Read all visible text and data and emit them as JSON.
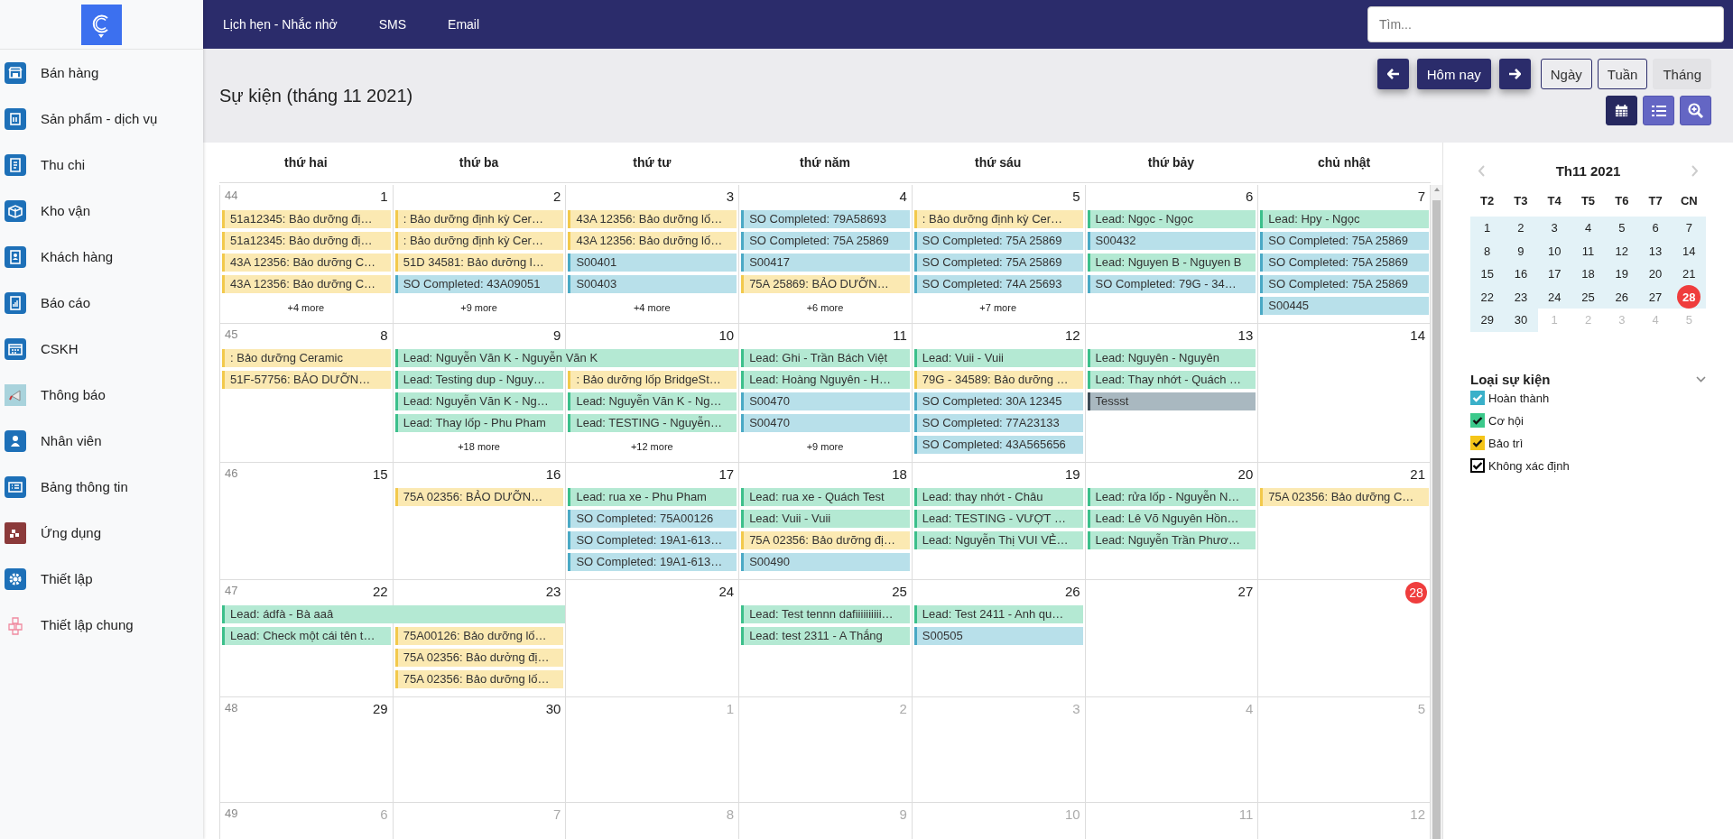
{
  "sidebar": {
    "items": [
      {
        "label": "Bán hàng"
      },
      {
        "label": "Sản phẩm - dịch vụ"
      },
      {
        "label": "Thu chi"
      },
      {
        "label": "Kho vận"
      },
      {
        "label": "Khách hàng"
      },
      {
        "label": "Báo cáo"
      },
      {
        "label": "CSKH"
      },
      {
        "label": "Thông báo"
      },
      {
        "label": "Nhân viên"
      },
      {
        "label": "Bảng thông tin"
      },
      {
        "label": "Ứng dụng"
      },
      {
        "label": "Thiết lập"
      },
      {
        "label": "Thiết lập chung"
      }
    ]
  },
  "top_nav": {
    "items": [
      {
        "label": "Lịch hẹn - Nhắc nhở"
      },
      {
        "label": "SMS"
      },
      {
        "label": "Email"
      }
    ]
  },
  "search": {
    "placeholder": "Tìm..."
  },
  "page_title": "Sự kiện (tháng 11 2021)",
  "toolbar": {
    "today_button": "Hôm nay",
    "views": [
      {
        "label": "Ngày",
        "selected": false
      },
      {
        "label": "Tuần",
        "selected": false
      },
      {
        "label": "Tháng",
        "selected": true
      }
    ],
    "display_buttons": [
      {
        "kind": "calendar",
        "selected": true
      },
      {
        "kind": "list",
        "selected": false
      },
      {
        "kind": "zoom",
        "selected": false
      }
    ]
  },
  "calendar": {
    "weekday_headers": [
      "thứ hai",
      "thứ ba",
      "thứ tư",
      "thứ năm",
      "thứ sáu",
      "thứ bảy",
      "chủ nhật"
    ],
    "weeks": [
      {
        "week": "44",
        "days": [
          {
            "number": "1",
            "other_month": false,
            "today": false,
            "more": "+4 more",
            "events": [
              {
                "kind": "maintenance",
                "text": "51a12345: Bảo dưỡng đị…",
                "continues": false
              },
              {
                "kind": "maintenance",
                "text": "51a12345: Bảo dưỡng đị…",
                "continues": false
              },
              {
                "kind": "maintenance",
                "text": "43A 12356: Bảo dưỡng C…",
                "continues": false
              },
              {
                "kind": "maintenance",
                "text": "43A 12356: Bảo dưỡng C…",
                "continues": false
              }
            ]
          },
          {
            "number": "2",
            "other_month": false,
            "today": false,
            "more": "+9 more",
            "events": [
              {
                "kind": "maintenance",
                "text": ": Bảo dưỡng định kỳ Cer…",
                "continues": false
              },
              {
                "kind": "maintenance",
                "text": ": Bảo dưỡng định kỳ Cer…",
                "continues": false
              },
              {
                "kind": "maintenance",
                "text": "51D 34581: Bảo dưỡng l…",
                "continues": false
              },
              {
                "kind": "completed",
                "text": "SO Completed: 43A09051",
                "continues": false
              }
            ]
          },
          {
            "number": "3",
            "other_month": false,
            "today": false,
            "more": "+4 more",
            "events": [
              {
                "kind": "maintenance",
                "text": "43A 12356: Bảo dưỡng lố…",
                "continues": false
              },
              {
                "kind": "maintenance",
                "text": "43A 12356: Bảo dưỡng lố…",
                "continues": false
              },
              {
                "kind": "completed",
                "text": "S00401",
                "continues": false
              },
              {
                "kind": "completed",
                "text": "S00403",
                "continues": false
              }
            ]
          },
          {
            "number": "4",
            "other_month": false,
            "today": false,
            "more": "+6 more",
            "events": [
              {
                "kind": "completed",
                "text": "SO Completed: 79A58693",
                "continues": false
              },
              {
                "kind": "completed",
                "text": "SO Completed: 75A 25869",
                "continues": false
              },
              {
                "kind": "completed",
                "text": "S00417",
                "continues": false
              },
              {
                "kind": "maintenance",
                "text": "75A 25869: BẢO DƯỠN…",
                "continues": false
              }
            ]
          },
          {
            "number": "5",
            "other_month": false,
            "today": false,
            "more": "+7 more",
            "events": [
              {
                "kind": "maintenance",
                "text": ": Bảo dưỡng định kỳ Cer…",
                "continues": false
              },
              {
                "kind": "completed",
                "text": "SO Completed: 75A 25869",
                "continues": false
              },
              {
                "kind": "completed",
                "text": "SO Completed: 75A 25869",
                "continues": false
              },
              {
                "kind": "completed",
                "text": "SO Completed: 74A 25693",
                "continues": false
              }
            ]
          },
          {
            "number": "6",
            "other_month": false,
            "today": false,
            "events": [
              {
                "kind": "lead",
                "text": "Lead: Ngọc - Ngọc",
                "continues": false
              },
              {
                "kind": "completed",
                "text": "S00432",
                "continues": false
              },
              {
                "kind": "lead",
                "text": "Lead: Nguyen B - Nguyen B",
                "continues": false
              },
              {
                "kind": "completed",
                "text": "SO Completed: 79G - 34…",
                "continues": false
              }
            ]
          },
          {
            "number": "7",
            "other_month": false,
            "today": false,
            "events": [
              {
                "kind": "lead",
                "text": "Lead: Hpy - Ngọc",
                "continues": false
              },
              {
                "kind": "completed",
                "text": "SO Completed: 75A 25869",
                "continues": false
              },
              {
                "kind": "completed",
                "text": "SO Completed: 75A 25869",
                "continues": false
              },
              {
                "kind": "completed",
                "text": "SO Completed: 75A 25869",
                "continues": false
              },
              {
                "kind": "completed",
                "text": "S00445",
                "continues": false
              }
            ]
          }
        ]
      },
      {
        "week": "45",
        "days": [
          {
            "number": "8",
            "other_month": false,
            "today": false,
            "events": [
              {
                "kind": "maintenance",
                "text": ": Bảo dưỡng Ceramic",
                "continues": false
              },
              {
                "kind": "maintenance",
                "text": "51F-57756: BẢO DƯỠN…",
                "continues": false
              }
            ]
          },
          {
            "number": "9",
            "other_month": false,
            "today": false,
            "more": "+18 more",
            "events": [
              {
                "kind": "lead",
                "text": "Lead: Nguyễn Văn K - Nguyễn Văn K",
                "continues": true
              },
              {
                "kind": "lead",
                "text": "Lead: Testing dup - Nguy…",
                "continues": false
              },
              {
                "kind": "lead",
                "text": "Lead: Nguyễn Văn K - Ng…",
                "continues": false
              },
              {
                "kind": "lead",
                "text": "Lead: Thay lốp - Phu Pham",
                "continues": false
              }
            ]
          },
          {
            "number": "10",
            "other_month": false,
            "today": false,
            "more": "+12 more",
            "events": [
              {
                "kind": "maintenance",
                "text": ": Bảo dưỡng lốp BridgeSt…",
                "continues": false
              },
              {
                "kind": "lead",
                "text": "Lead: Nguyễn Văn K - Ng…",
                "continues": false
              },
              {
                "kind": "lead",
                "text": "Lead: TESTING - Nguyễn…",
                "continues": false
              }
            ]
          },
          {
            "number": "11",
            "other_month": false,
            "today": false,
            "more": "+9 more",
            "events": [
              {
                "kind": "lead",
                "text": "Lead: Ghi - Trần Bách Việt",
                "continues": false
              },
              {
                "kind": "lead",
                "text": "Lead: Hoàng Nguyên - H…",
                "continues": false
              },
              {
                "kind": "completed",
                "text": "S00470",
                "continues": false
              },
              {
                "kind": "completed",
                "text": "S00470",
                "continues": false
              }
            ]
          },
          {
            "number": "12",
            "other_month": false,
            "today": false,
            "events": [
              {
                "kind": "lead",
                "text": "Lead: Vuii - Vuii",
                "continues": false
              },
              {
                "kind": "maintenance",
                "text": "79G - 34589: Bảo dưỡng …",
                "continues": false
              },
              {
                "kind": "completed",
                "text": "SO Completed: 30A 12345",
                "continues": false
              },
              {
                "kind": "completed",
                "text": "SO Completed: 77A23133",
                "continues": false
              },
              {
                "kind": "completed",
                "text": "SO Completed: 43A565656",
                "continues": false
              }
            ]
          },
          {
            "number": "13",
            "other_month": false,
            "today": false,
            "events": [
              {
                "kind": "lead",
                "text": "Lead: Nguyên - Nguyên",
                "continues": false
              },
              {
                "kind": "lead",
                "text": "Lead: Thay nhớt - Quách …",
                "continues": false
              },
              {
                "kind": "other",
                "text": "Tessst",
                "continues": false
              }
            ]
          },
          {
            "number": "14",
            "other_month": false,
            "today": false
          }
        ]
      },
      {
        "week": "46",
        "days": [
          {
            "number": "15",
            "other_month": false,
            "today": false
          },
          {
            "number": "16",
            "other_month": false,
            "today": false,
            "events": [
              {
                "kind": "maintenance",
                "text": "75A 02356: BẢO DƯỠN…",
                "continues": false
              }
            ]
          },
          {
            "number": "17",
            "other_month": false,
            "today": false,
            "events": [
              {
                "kind": "lead",
                "text": "Lead: rua xe - Phu Pham",
                "continues": false
              },
              {
                "kind": "completed",
                "text": "SO Completed: 75A00126",
                "continues": false
              },
              {
                "kind": "completed",
                "text": "SO Completed: 19A1-613…",
                "continues": false
              },
              {
                "kind": "completed",
                "text": "SO Completed: 19A1-613…",
                "continues": false
              }
            ]
          },
          {
            "number": "18",
            "other_month": false,
            "today": false,
            "events": [
              {
                "kind": "lead",
                "text": "Lead: rua xe - Quách Test",
                "continues": false
              },
              {
                "kind": "lead",
                "text": "Lead: Vuii - Vuii",
                "continues": false
              },
              {
                "kind": "maintenance",
                "text": "75A 02356: Bảo dưỡng đị…",
                "continues": false
              },
              {
                "kind": "completed",
                "text": "S00490",
                "continues": false
              }
            ]
          },
          {
            "number": "19",
            "other_month": false,
            "today": false,
            "events": [
              {
                "kind": "lead",
                "text": "Lead: thay nhớt - Châu",
                "continues": false
              },
              {
                "kind": "lead",
                "text": "Lead: TESTING - VƯỢT …",
                "continues": false
              },
              {
                "kind": "lead",
                "text": "Lead: Nguyễn Thị VUI VẺ…",
                "continues": false
              }
            ]
          },
          {
            "number": "20",
            "other_month": false,
            "today": false,
            "events": [
              {
                "kind": "lead",
                "text": "Lead: rửa lốp - Nguyễn N…",
                "continues": false
              },
              {
                "kind": "lead",
                "text": "Lead: Lê Võ Nguyên Hồn…",
                "continues": false
              },
              {
                "kind": "lead",
                "text": "Lead: Nguyễn Trần Phươ…",
                "continues": false
              }
            ]
          },
          {
            "number": "21",
            "other_month": false,
            "today": false,
            "events": [
              {
                "kind": "maintenance",
                "text": "75A 02356: Bảo dưỡng C…",
                "continues": false
              }
            ]
          }
        ]
      },
      {
        "week": "47",
        "days": [
          {
            "number": "22",
            "other_month": false,
            "today": false,
            "events": [
              {
                "kind": "lead",
                "text": "Lead: ádfà - Bà aaâ",
                "continues": true
              },
              {
                "kind": "lead",
                "text": "Lead: Check một cái tên t…",
                "continues": false
              }
            ]
          },
          {
            "number": "23",
            "other_month": false,
            "today": false,
            "events": [
              {
                "kind": "maintenance",
                "text": "75A00126: Bảo dưỡng lố…",
                "continues": false
              },
              {
                "kind": "maintenance",
                "text": "75A 02356: Bảo dưởng đị…",
                "continues": false
              },
              {
                "kind": "maintenance",
                "text": "75A 02356: Bảo dưỡng lố…",
                "continues": false
              }
            ]
          },
          {
            "number": "24",
            "other_month": false,
            "today": false
          },
          {
            "number": "25",
            "other_month": false,
            "today": false,
            "events": [
              {
                "kind": "lead",
                "text": "Lead: Test tennn dafiiiiiiiiii…",
                "continues": false
              },
              {
                "kind": "lead",
                "text": "Lead: test 2311 - A Thắng",
                "continues": false
              }
            ]
          },
          {
            "number": "26",
            "other_month": false,
            "today": false,
            "events": [
              {
                "kind": "lead",
                "text": "Lead: Test 2411 - Anh qu…",
                "continues": false
              },
              {
                "kind": "completed",
                "text": "S00505",
                "continues": false
              }
            ]
          },
          {
            "number": "27",
            "other_month": false,
            "today": false
          },
          {
            "number": "28",
            "other_month": false,
            "today": true
          }
        ]
      },
      {
        "week": "48",
        "days": [
          {
            "number": "29",
            "other_month": false,
            "today": false
          },
          {
            "number": "30",
            "other_month": false,
            "today": false
          },
          {
            "number": "1",
            "other_month": true,
            "today": false
          },
          {
            "number": "2",
            "other_month": true,
            "today": false
          },
          {
            "number": "3",
            "other_month": true,
            "today": false
          },
          {
            "number": "4",
            "other_month": true,
            "today": false
          },
          {
            "number": "5",
            "other_month": true,
            "today": false
          }
        ]
      },
      {
        "week": "49",
        "days": [
          {
            "number": "6",
            "other_month": true,
            "today": false
          },
          {
            "number": "7",
            "other_month": true,
            "today": false
          },
          {
            "number": "8",
            "other_month": true,
            "today": false
          },
          {
            "number": "9",
            "other_month": true,
            "today": false
          },
          {
            "number": "10",
            "other_month": true,
            "today": false
          },
          {
            "number": "11",
            "other_month": true,
            "today": false
          },
          {
            "number": "12",
            "other_month": true,
            "today": false
          }
        ]
      }
    ]
  },
  "mini_calendar": {
    "title": "Th11 2021",
    "weekdays": [
      "T2",
      "T3",
      "T4",
      "T5",
      "T6",
      "T7",
      "CN"
    ],
    "weeks": [
      [
        {
          "day": "1",
          "in_month": true,
          "today": false
        },
        {
          "day": "2",
          "in_month": true,
          "today": false
        },
        {
          "day": "3",
          "in_month": true,
          "today": false
        },
        {
          "day": "4",
          "in_month": true,
          "today": false
        },
        {
          "day": "5",
          "in_month": true,
          "today": false
        },
        {
          "day": "6",
          "in_month": true,
          "today": false
        },
        {
          "day": "7",
          "in_month": true,
          "today": false
        }
      ],
      [
        {
          "day": "8",
          "in_month": true,
          "today": false
        },
        {
          "day": "9",
          "in_month": true,
          "today": false
        },
        {
          "day": "10",
          "in_month": true,
          "today": false
        },
        {
          "day": "11",
          "in_month": true,
          "today": false
        },
        {
          "day": "12",
          "in_month": true,
          "today": false
        },
        {
          "day": "13",
          "in_month": true,
          "today": false
        },
        {
          "day": "14",
          "in_month": true,
          "today": false
        }
      ],
      [
        {
          "day": "15",
          "in_month": true,
          "today": false
        },
        {
          "day": "16",
          "in_month": true,
          "today": false
        },
        {
          "day": "17",
          "in_month": true,
          "today": false
        },
        {
          "day": "18",
          "in_month": true,
          "today": false
        },
        {
          "day": "19",
          "in_month": true,
          "today": false
        },
        {
          "day": "20",
          "in_month": true,
          "today": false
        },
        {
          "day": "21",
          "in_month": true,
          "today": false
        }
      ],
      [
        {
          "day": "22",
          "in_month": true,
          "today": false
        },
        {
          "day": "23",
          "in_month": true,
          "today": false
        },
        {
          "day": "24",
          "in_month": true,
          "today": false
        },
        {
          "day": "25",
          "in_month": true,
          "today": false
        },
        {
          "day": "26",
          "in_month": true,
          "today": false
        },
        {
          "day": "27",
          "in_month": true,
          "today": false
        },
        {
          "day": "28",
          "in_month": true,
          "today": true
        }
      ],
      [
        {
          "day": "29",
          "in_month": true,
          "today": false
        },
        {
          "day": "30",
          "in_month": true,
          "today": false
        },
        {
          "day": "1",
          "in_month": false,
          "today": false
        },
        {
          "day": "2",
          "in_month": false,
          "today": false
        },
        {
          "day": "3",
          "in_month": false,
          "today": false
        },
        {
          "day": "4",
          "in_month": false,
          "today": false
        },
        {
          "day": "5",
          "in_month": false,
          "today": false
        }
      ]
    ]
  },
  "event_filter": {
    "title": "Loại sự kiện",
    "items": [
      {
        "label": "Hoàn thành",
        "checked": true,
        "color": "#3ab0c9"
      },
      {
        "label": "Cơ hội",
        "checked": true,
        "color": "#3cc98b"
      },
      {
        "label": "Bảo trì",
        "checked": true,
        "color": "#f5c518"
      },
      {
        "label": "Không xác định",
        "checked": true,
        "color": "#000000"
      }
    ]
  }
}
